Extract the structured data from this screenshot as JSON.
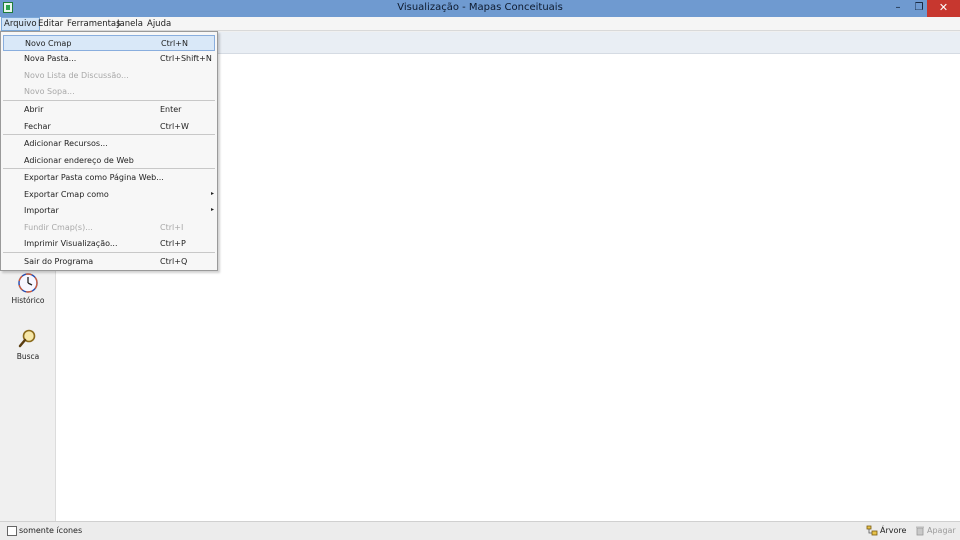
{
  "window": {
    "title": "Visualização - Mapas Conceituais",
    "min_glyph": "–",
    "restore_glyph": "❐",
    "close_glyph": "✕"
  },
  "menubar": {
    "items": [
      {
        "label": "Arquivo",
        "open": true
      },
      {
        "label": "Editar"
      },
      {
        "label": "Ferramentas"
      },
      {
        "label": "Janela"
      },
      {
        "label": "Ajuda"
      }
    ]
  },
  "arquivo_menu": {
    "items": [
      {
        "label": "Novo Cmap",
        "shortcut": "Ctrl+N",
        "highlighted": true
      },
      {
        "label": "Nova Pasta...",
        "shortcut": "Ctrl+Shift+N"
      },
      {
        "label": "Novo Lista de Discussão...",
        "shortcut": "",
        "disabled": true
      },
      {
        "label": "Novo Sopa...",
        "shortcut": "",
        "disabled": true
      },
      {
        "label": "Abrir",
        "shortcut": "Enter"
      },
      {
        "label": "Fechar",
        "shortcut": "Ctrl+W"
      },
      {
        "label": "Adicionar Recursos...",
        "shortcut": ""
      },
      {
        "label": "Adicionar endereço de Web",
        "shortcut": ""
      },
      {
        "label": "Exportar Pasta como Página Web...",
        "shortcut": ""
      },
      {
        "label": "Exportar Cmap como",
        "shortcut": "",
        "submenu": true
      },
      {
        "label": "Importar",
        "shortcut": "",
        "submenu": true
      },
      {
        "label": "Fundir Cmap(s)...",
        "shortcut": "Ctrl+I",
        "disabled": true
      },
      {
        "label": "Imprimir Visualização...",
        "shortcut": "Ctrl+P"
      },
      {
        "label": "Sair do Programa",
        "shortcut": "Ctrl+Q"
      }
    ]
  },
  "sidebar": {
    "items": [
      {
        "label": "Histórico",
        "icon": "clock-icon"
      },
      {
        "label": "Busca",
        "icon": "magnifier-icon"
      }
    ]
  },
  "statusbar": {
    "checkbox_label": "somente ícones",
    "checked": false,
    "tree_label": "Árvore",
    "delete_label": "Apagar"
  },
  "colors": {
    "titlebar": "#6f9ad0",
    "close_button": "#c7372f",
    "menu_highlight": "#d9e8f8"
  }
}
